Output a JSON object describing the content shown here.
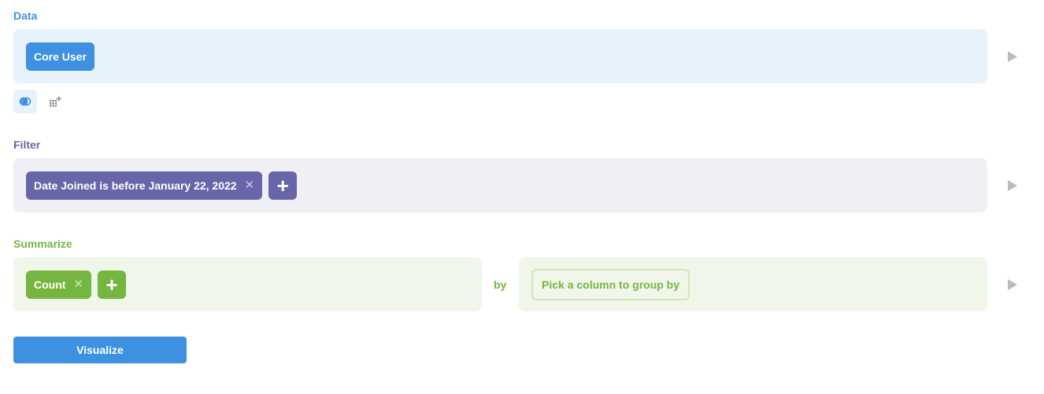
{
  "data_section": {
    "title": "Data",
    "table_label": "Core User"
  },
  "filter_section": {
    "title": "Filter",
    "filter_label": "Date Joined is before January 22, 2022",
    "remove_glyph": "✕",
    "add_glyph": "+"
  },
  "summarize_section": {
    "title": "Summarize",
    "metric_label": "Count",
    "remove_glyph": "✕",
    "add_glyph": "+",
    "by_label": "by",
    "group_by_placeholder": "Pick a column to group by"
  },
  "actions": {
    "visualize_label": "Visualize"
  },
  "icons": {
    "join": "join-icon",
    "custom_column": "custom-column-icon",
    "preview": "play-icon"
  },
  "colors": {
    "data_accent": "#3d91e0",
    "filter_accent": "#6866a8",
    "summarize_accent": "#74b63f",
    "preview_icon": "#b8bbc3"
  }
}
